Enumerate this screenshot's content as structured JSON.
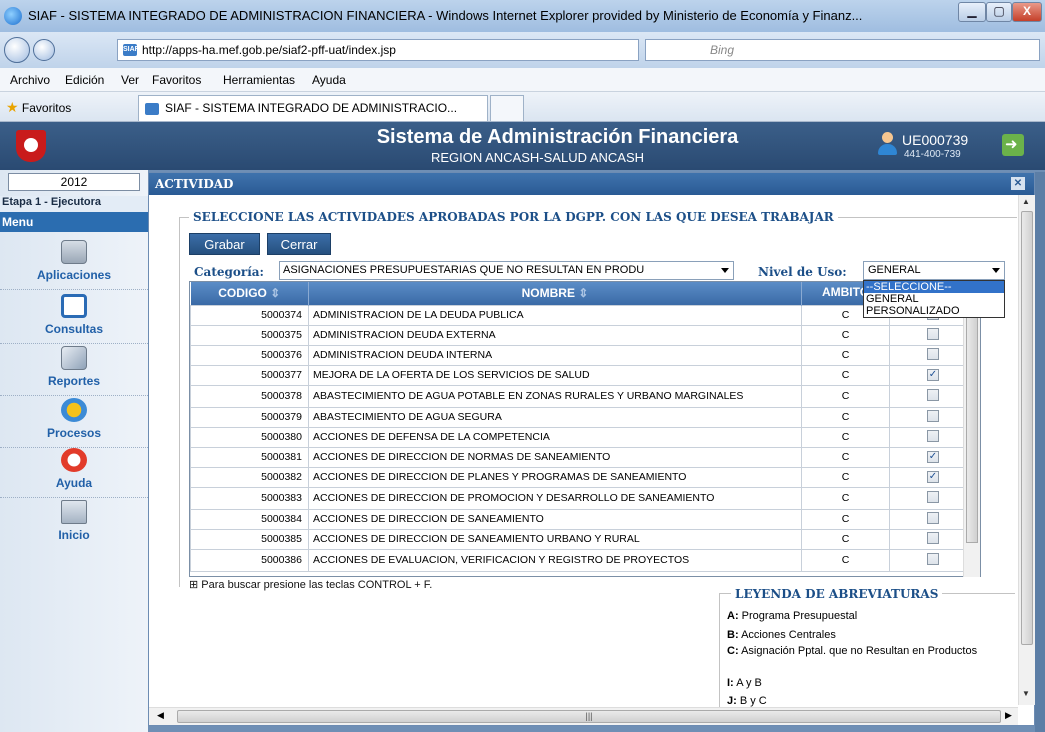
{
  "window": {
    "title": "SIAF - SISTEMA INTEGRADO DE ADMINISTRACION FINANCIERA - Windows Internet Explorer provided by Ministerio de Economía y Finanz...",
    "minimize": "▁",
    "maximize": "▢",
    "close": "X"
  },
  "browser": {
    "url": "http://apps-ha.mef.gob.pe/siaf2-pff-uat/index.jsp",
    "search_placeholder": "Bing",
    "menu": [
      "Archivo",
      "Edición",
      "Ver",
      "Favoritos",
      "Herramientas",
      "Ayuda"
    ],
    "favorites_label": "Favoritos",
    "tab_label": "SIAF - SISTEMA INTEGRADO DE ADMINISTRACIO..."
  },
  "app": {
    "title": "Sistema de Administración Financiera",
    "subtitle": "REGION ANCASH-SALUD ANCASH",
    "user": "UE000739",
    "user_code": "441-400-739"
  },
  "sidebar": {
    "year": "2012",
    "etapa": "Etapa 1 - Ejecutora",
    "menu_header": "Menu",
    "items": [
      {
        "label": "Aplicaciones",
        "icon": "calculator-icon"
      },
      {
        "label": "Consultas",
        "icon": "search-icon"
      },
      {
        "label": "Reportes",
        "icon": "report-icon"
      },
      {
        "label": "Procesos",
        "icon": "gears-icon"
      },
      {
        "label": "Ayuda",
        "icon": "help-icon"
      },
      {
        "label": "Inicio",
        "icon": "home-icon"
      }
    ]
  },
  "dialog": {
    "title": "ACTIVIDAD",
    "section_title": "SELECCIONE LAS ACTIVIDADES APROBADAS POR LA DGPP. CON LAS QUE DESEA TRABAJAR",
    "buttons": {
      "save": "Grabar",
      "close": "Cerrar"
    },
    "categoria_label": "Categoría:",
    "categoria_value": "ASIGNACIONES PRESUPUESTARIAS QUE NO RESULTAN EN PRODU",
    "nivel_label": "Nivel de Uso:",
    "nivel_value": "GENERAL",
    "nivel_options": [
      "--SELECCIONE--",
      "GENERAL",
      "PERSONALIZADO"
    ],
    "columns": {
      "codigo": "CODIGO",
      "nombre": "NOMBRE",
      "ambito": "AMBITO"
    },
    "rows": [
      {
        "codigo": "5000374",
        "nombre": "ADMINISTRACION DE LA DEUDA PUBLICA",
        "ambito": "C",
        "checked": false
      },
      {
        "codigo": "5000375",
        "nombre": "ADMINISTRACION DEUDA EXTERNA",
        "ambito": "C",
        "checked": false
      },
      {
        "codigo": "5000376",
        "nombre": "ADMINISTRACION DEUDA INTERNA",
        "ambito": "C",
        "checked": false
      },
      {
        "codigo": "5000377",
        "nombre": "MEJORA DE LA OFERTA DE LOS SERVICIOS DE SALUD",
        "ambito": "C",
        "checked": true
      },
      {
        "codigo": "5000378",
        "nombre": "ABASTECIMIENTO DE AGUA POTABLE EN ZONAS RURALES Y URBANO MARGINALES",
        "ambito": "C",
        "checked": false
      },
      {
        "codigo": "5000379",
        "nombre": "ABASTECIMIENTO DE AGUA SEGURA",
        "ambito": "C",
        "checked": false
      },
      {
        "codigo": "5000380",
        "nombre": "ACCIONES DE DEFENSA DE LA COMPETENCIA",
        "ambito": "C",
        "checked": false
      },
      {
        "codigo": "5000381",
        "nombre": "ACCIONES DE DIRECCION DE NORMAS DE SANEAMIENTO",
        "ambito": "C",
        "checked": true
      },
      {
        "codigo": "5000382",
        "nombre": "ACCIONES DE DIRECCION DE PLANES Y PROGRAMAS DE SANEAMIENTO",
        "ambito": "C",
        "checked": true
      },
      {
        "codigo": "5000383",
        "nombre": "ACCIONES DE DIRECCION DE PROMOCION Y DESARROLLO DE SANEAMIENTO",
        "ambito": "C",
        "checked": false
      },
      {
        "codigo": "5000384",
        "nombre": "ACCIONES DE DIRECCION DE SANEAMIENTO",
        "ambito": "C",
        "checked": false
      },
      {
        "codigo": "5000385",
        "nombre": "ACCIONES DE DIRECCION DE SANEAMIENTO URBANO Y RURAL",
        "ambito": "C",
        "checked": false
      },
      {
        "codigo": "5000386",
        "nombre": "ACCIONES DE EVALUACION, VERIFICACION Y REGISTRO DE PROYECTOS",
        "ambito": "C",
        "checked": false
      }
    ],
    "hint": "Para buscar presione las teclas CONTROL + F.",
    "legend_title": "LEYENDA DE ABREVIATURAS",
    "legend": [
      {
        "k": "A:",
        "v": "Programa Presupuestal"
      },
      {
        "k": "B:",
        "v": "Acciones Centrales"
      },
      {
        "k": "C:",
        "v": "Asignación Pptal. que no Resultan en Productos"
      },
      {
        "k": "I:",
        "v": "A y B"
      },
      {
        "k": "J:",
        "v": "B y C"
      }
    ]
  }
}
